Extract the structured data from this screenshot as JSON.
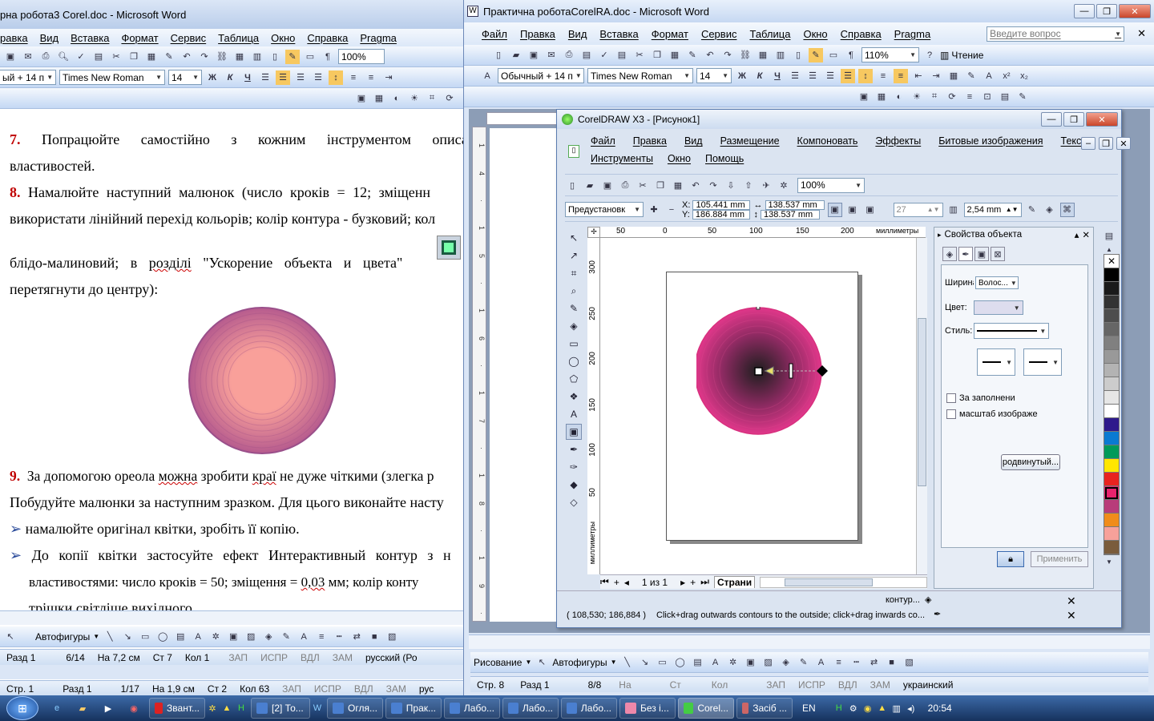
{
  "word_left": {
    "title": "рна робота3 Corel.doc - Microsoft Word",
    "menu": [
      "равка",
      "Вид",
      "Вставка",
      "Формат",
      "Сервис",
      "Таблица",
      "Окно",
      "Справка",
      "Pragma"
    ],
    "zoom": "100%",
    "style": "ый + 14 п",
    "font": "Times New Roman",
    "size": "14",
    "para7_num": "7.",
    "para7_text": "Попрацюйте самостійно з кожним інструментом описан",
    "para7_line2": "властивостей.",
    "para8_num": "8.",
    "para8_text": "Намалюйте наступний малюнок (число кроків = 12; зміщенн",
    "para8_line2": "використати лінійний перехід кольорів; колір контура - бузковий; кол",
    "para8_line3a": "блідо-малиновий; в ",
    "para8_line3b": "розділі",
    "para8_line3c": " \"Ускорение объекта и цвета\"",
    "para8_line4": "перетягнути до центру):",
    "para9_num": "9.",
    "para9_a": "За допомогою ореола ",
    "para9_b": "можна",
    "para9_c": " зробити ",
    "para9_d": "краї",
    "para9_e": " не дуже чіткими (злегка р",
    "para9_line2": "Побудуйте малюнки за наступним зразком. Для цього виконайте насту",
    "bullet1": "намалюйте оригінал квітки, зробіть її копію.",
    "bullet2": "До копії квітки застосуйте ефект Интерактивный контур з н",
    "bullet2_line2a": "властивостями: число кроків = 50; зміщення = ",
    "bullet2_line2b": "0,03",
    "bullet2_line2c": " мм; колір конту",
    "bullet2_line3": "трішки світліше вихідного.",
    "draw_label": "Автофигуры",
    "status": [
      "Разд 1",
      "6/14",
      "На 7,2 см",
      "Ст 7",
      "Кол 1",
      "ЗАП",
      "ИСПР",
      "ВДЛ",
      "ЗАМ",
      "русский (Ро"
    ],
    "status_bottom": [
      "Стр. 1",
      "Разд 1",
      "1/17",
      "На 1,9 см",
      "Ст 2",
      "Кол 63",
      "ЗАП",
      "ИСПР",
      "ВДЛ",
      "ЗАМ",
      "рус"
    ]
  },
  "word_right": {
    "title": "Практична роботаCorelRA.doc - Microsoft Word",
    "menu": [
      "Файл",
      "Правка",
      "Вид",
      "Вставка",
      "Формат",
      "Сервис",
      "Таблица",
      "Окно",
      "Справка",
      "Pragma"
    ],
    "ask_placeholder": "Введите вопрос",
    "zoom": "110%",
    "read_label": "Чтение",
    "style": "Обычный + 14 п",
    "font": "Times New Roman",
    "size": "14",
    "draw_label": "Рисование",
    "autoshapes_label": "Автофигуры",
    "status": [
      "Стр. 8",
      "Разд 1",
      "8/8",
      "На",
      "Ст",
      "Кол",
      "ЗАП",
      "ИСПР",
      "ВДЛ",
      "ЗАМ",
      "украинский"
    ]
  },
  "corel": {
    "title": "CorelDRAW X3 - [Рисунок1]",
    "menu_row1": [
      "Файл",
      "Правка",
      "Вид",
      "Размещение",
      "Компоновать",
      "Эффекты",
      "Битовые изображения",
      "Текст"
    ],
    "menu_row2": [
      "Инструменты",
      "Окно",
      "Помощь"
    ],
    "zoom": "100%",
    "preset": "Предустановк",
    "x": "105.441 mm",
    "y": "186.884 mm",
    "w": "138.537 mm",
    "h": "138.537 mm",
    "x_label": "X:",
    "y_label": "Y:",
    "steps": "27",
    "offset": "2,54 mm",
    "ruler_h": [
      "50",
      "0",
      "50",
      "100",
      "150",
      "200",
      "миллиметры"
    ],
    "ruler_v": [
      "300",
      "250",
      "200",
      "150",
      "100",
      "50",
      "миллиметры"
    ],
    "page_nav": "1 из 1",
    "page_tab": "Страни",
    "status_coords": "( 108,530; 186,884 )",
    "status_hint": "Click+drag outwards contours to the outside; click+drag inwards co...",
    "contour_label": "контур...",
    "props_title": "Свойства объекта",
    "width_label": "Ширина",
    "width_value": "Волос...",
    "color_label": "Цвет:",
    "style_label": "Стиль:",
    "behind_fill": "За заполнени",
    "scale_image": "масштаб изображе",
    "advanced_button": "родвинутый...",
    "apply_button": "Применить",
    "palette": [
      "#ffffff",
      "#000000",
      "#1a1a1a",
      "#333333",
      "#4d4d4d",
      "#666666",
      "#808080",
      "#999999",
      "#b3b3b3",
      "#cccccc",
      "#e6e6e6",
      "#ffffff",
      "#2e1a8c",
      "#0a7ad1",
      "#009a5a",
      "#ffe600",
      "#e8231f",
      "#e8236d",
      "#b83c7a",
      "#f08c1a",
      "#f7a19a",
      "#7a5c3c"
    ]
  },
  "taskbar": {
    "items": [
      "Звант...",
      "[2] То...",
      "Огля...",
      "Прак...",
      "Лабо...",
      "Лабо...",
      "Лабо...",
      "Без і...",
      "Corel...",
      "Засіб ..."
    ],
    "lang": "EN",
    "time": "20:54"
  }
}
